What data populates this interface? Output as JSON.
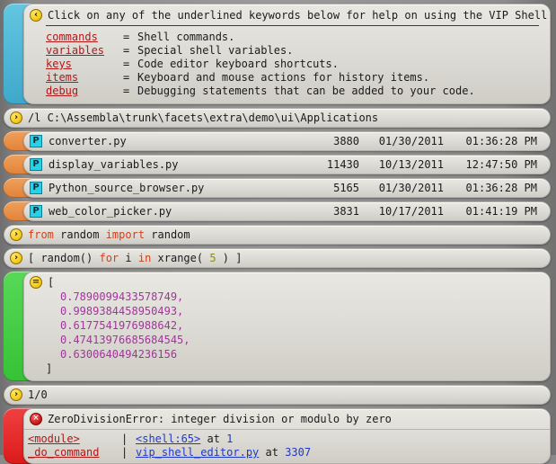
{
  "help": {
    "icon": "collapse-left-icon",
    "icon_glyph": "‹",
    "headline": "Click on any of the underlined keywords below for help on using the VIP Shell:",
    "rows": [
      {
        "keyword": "commands",
        "eq": "=",
        "description": "Shell commands."
      },
      {
        "keyword": "variables",
        "eq": "=",
        "description": "Special shell variables."
      },
      {
        "keyword": "keys",
        "eq": "=",
        "description": "Code editor keyboard shortcuts."
      },
      {
        "keyword": "items",
        "eq": "=",
        "description": "Keyboard and mouse actions for history items."
      },
      {
        "keyword": "debug",
        "eq": "=",
        "description": "Debugging statements that can be added to your code."
      }
    ]
  },
  "path_command": {
    "icon": "prompt-icon",
    "icon_glyph": "›",
    "text": "/l C:\\Assembla\\trunk\\facets\\extra\\demo\\ui\\Applications"
  },
  "files": {
    "badge": "P",
    "rows": [
      {
        "name": "converter.py",
        "size": "3880",
        "date": "01/30/2011",
        "time": "01:36:28 PM"
      },
      {
        "name": "display_variables.py",
        "size": "11430",
        "date": "10/13/2011",
        "time": "12:47:50 PM"
      },
      {
        "name": "Python_source_browser.py",
        "size": "5165",
        "date": "01/30/2011",
        "time": "01:36:28 PM"
      },
      {
        "name": "web_color_picker.py",
        "size": "3831",
        "date": "10/17/2011",
        "time": "01:41:19 PM"
      }
    ]
  },
  "commands": [
    {
      "icon": "prompt-icon",
      "icon_glyph": "›",
      "tokens": [
        {
          "t": "from",
          "c": "kwd"
        },
        {
          "t": " random ",
          "c": ""
        },
        {
          "t": "import",
          "c": "kwd"
        },
        {
          "t": " random",
          "c": ""
        }
      ]
    },
    {
      "icon": "prompt-icon",
      "icon_glyph": "›",
      "tokens": [
        {
          "t": "[ random() ",
          "c": ""
        },
        {
          "t": "for",
          "c": "kwd"
        },
        {
          "t": " i ",
          "c": ""
        },
        {
          "t": "in",
          "c": "kwd"
        },
        {
          "t": " xrange( ",
          "c": ""
        },
        {
          "t": "5",
          "c": "num"
        },
        {
          "t": " ) ]",
          "c": ""
        }
      ]
    }
  ],
  "result": {
    "icon": "result-icon",
    "icon_glyph": "=",
    "open_bracket": "[",
    "values": [
      "0.7890099433578749,",
      "0.9989384458950493,",
      "0.6177541976988642,",
      "0.47413976685684545,",
      "0.6300640494236156"
    ],
    "close_bracket": "]"
  },
  "div_command": {
    "icon": "prompt-icon",
    "icon_glyph": "›",
    "text": "1/0"
  },
  "error": {
    "icon": "error-icon",
    "icon_glyph": "✕",
    "message": "ZeroDivisionError: integer division or modulo by zero",
    "traceback": [
      {
        "fn": "<module>",
        "bar": "|",
        "source": "<shell:65>",
        "at": "at",
        "line": "1"
      },
      {
        "fn": "_do_command",
        "bar": "|",
        "source": "vip_shell_editor.py",
        "at": "at",
        "line": "3307"
      }
    ]
  },
  "colors": {
    "background": "#8a8a8a",
    "panel": "#dedcd6",
    "tab_cyan": "#4db8d8",
    "tab_orange": "#e8893f",
    "tab_green": "#41cc41",
    "tab_red": "#e22222",
    "bullet_yellow": "#f6cf21",
    "bullet_red": "#d62020",
    "keyword_link": "#b01818",
    "syntax_keyword": "#d2401c",
    "syntax_number": "#8a8a1c",
    "result_value": "#a5339e",
    "source_link": "#2038c8",
    "python_badge": "#27d2e8"
  }
}
